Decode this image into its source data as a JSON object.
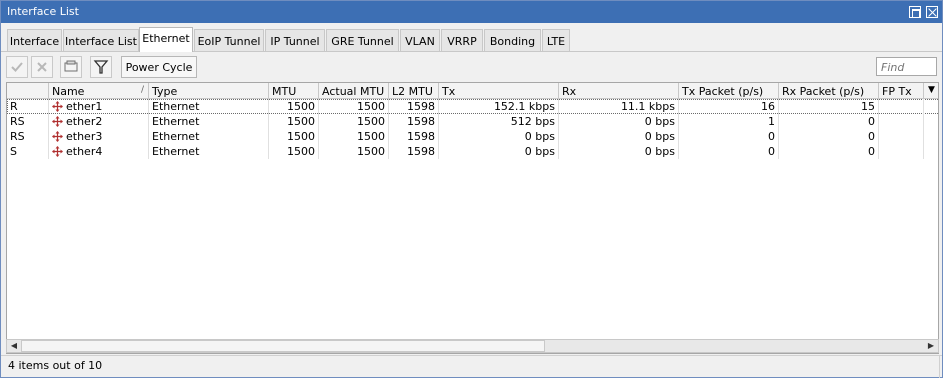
{
  "window": {
    "title": "Interface List"
  },
  "tabs": [
    {
      "label": "Interface"
    },
    {
      "label": "Interface List"
    },
    {
      "label": "Ethernet",
      "active": true
    },
    {
      "label": "EoIP Tunnel"
    },
    {
      "label": "IP Tunnel"
    },
    {
      "label": "GRE Tunnel"
    },
    {
      "label": "VLAN"
    },
    {
      "label": "VRRP"
    },
    {
      "label": "Bonding"
    },
    {
      "label": "LTE"
    }
  ],
  "toolbar": {
    "enable_icon": "check-icon",
    "disable_icon": "x-icon",
    "comment_icon": "comment-icon",
    "filter_icon": "filter-icon",
    "power_cycle_label": "Power Cycle",
    "find_placeholder": "Find"
  },
  "table": {
    "columns": [
      "Name",
      "Type",
      "MTU",
      "Actual MTU",
      "L2 MTU",
      "Tx",
      "Rx",
      "Tx Packet (p/s)",
      "Rx Packet (p/s)",
      "FP Tx"
    ],
    "rows": [
      {
        "flags": "R",
        "name": "ether1",
        "type": "Ethernet",
        "mtu": "1500",
        "actual_mtu": "1500",
        "l2_mtu": "1598",
        "tx": "152.1 kbps",
        "rx": "11.1 kbps",
        "tx_packet": "16",
        "rx_packet": "15",
        "fp_tx": ""
      },
      {
        "flags": "RS",
        "name": "ether2",
        "type": "Ethernet",
        "mtu": "1500",
        "actual_mtu": "1500",
        "l2_mtu": "1598",
        "tx": "512 bps",
        "rx": "0 bps",
        "tx_packet": "1",
        "rx_packet": "0",
        "fp_tx": ""
      },
      {
        "flags": "RS",
        "name": "ether3",
        "type": "Ethernet",
        "mtu": "1500",
        "actual_mtu": "1500",
        "l2_mtu": "1598",
        "tx": "0 bps",
        "rx": "0 bps",
        "tx_packet": "0",
        "rx_packet": "0",
        "fp_tx": ""
      },
      {
        "flags": "S",
        "name": "ether4",
        "type": "Ethernet",
        "mtu": "1500",
        "actual_mtu": "1500",
        "l2_mtu": "1598",
        "tx": "0 bps",
        "rx": "0 bps",
        "tx_packet": "0",
        "rx_packet": "0",
        "fp_tx": ""
      }
    ]
  },
  "status": {
    "text": "4 items out of 10"
  },
  "colors": {
    "titlebar": "#3d6fb4",
    "interface_icon": "#b03030"
  }
}
